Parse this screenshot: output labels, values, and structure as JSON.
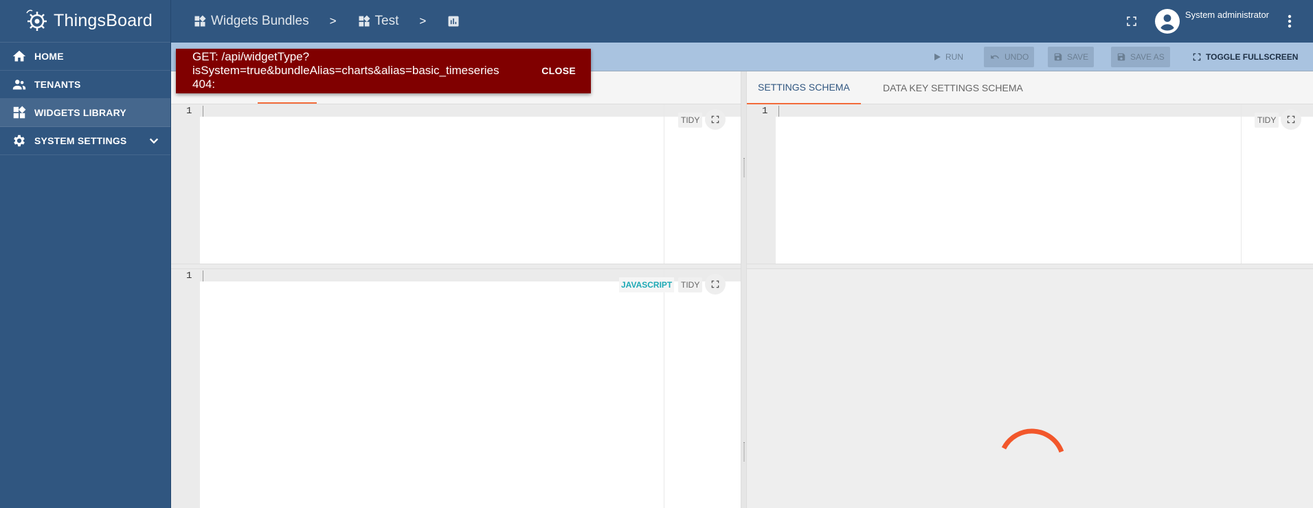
{
  "app": {
    "name": "ThingsBoard"
  },
  "sidebar": {
    "items": [
      {
        "label": "HOME",
        "icon": "home-icon"
      },
      {
        "label": "TENANTS",
        "icon": "people-icon"
      },
      {
        "label": "WIDGETS LIBRARY",
        "icon": "widgets-icon",
        "active": true
      },
      {
        "label": "SYSTEM SETTINGS",
        "icon": "gear-icon",
        "expandable": true
      }
    ]
  },
  "breadcrumb": {
    "items": [
      {
        "label": "Widgets Bundles",
        "icon": "widgets-icon"
      },
      {
        "label": "Test",
        "icon": "widgets-icon"
      },
      {
        "label": "",
        "icon": "chart-icon"
      }
    ],
    "separator": ">"
  },
  "header": {
    "user_name": "System administrator"
  },
  "toolbar": {
    "run": "RUN",
    "undo": "UNDO",
    "save": "SAVE",
    "save_as": "SAVE AS",
    "toggle_fullscreen": "TOGGLE FULLSCREEN"
  },
  "toast": {
    "line1": "GET: /api/widgetType?",
    "line2": "isSystem=true&bundleAlias=charts&alias=basic_timeseries",
    "line3": "404:",
    "close": "CLOSE",
    "color": "#800000"
  },
  "right_panel": {
    "tabs": [
      {
        "label": "SETTINGS SCHEMA",
        "active": true
      },
      {
        "label": "DATA KEY SETTINGS SCHEMA",
        "active": false
      }
    ]
  },
  "editors": {
    "line_number": "1",
    "tidy": "TIDY",
    "language": "JAVASCRIPT"
  },
  "colors": {
    "primary": "#305680",
    "accent": "#f26b3a",
    "toolbar": "#a9c3e0"
  }
}
